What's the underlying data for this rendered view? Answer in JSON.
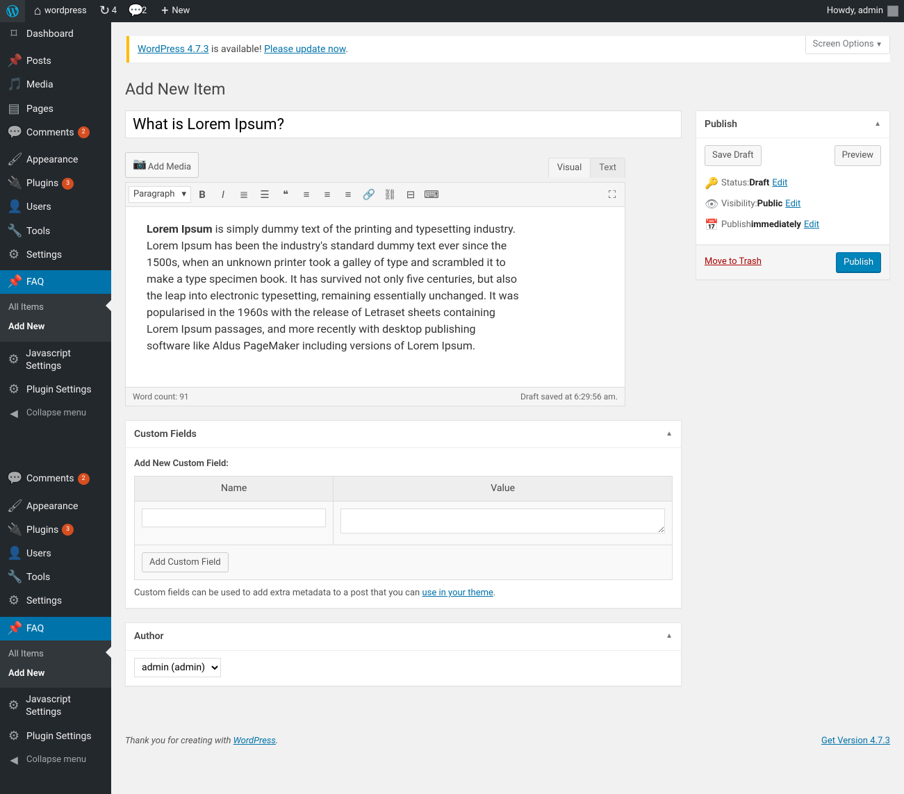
{
  "adminbar": {
    "site_name": "wordpress",
    "updates_count": "4",
    "comments_count": "2",
    "new_label": "New",
    "howdy": "Howdy, admin"
  },
  "screen_options": "Screen Options",
  "update_nag": {
    "link1": "WordPress 4.7.3",
    "mid": " is available! ",
    "link2": "Please update now"
  },
  "page_heading": "Add New Item",
  "title_value": "What is Lorem Ipsum?",
  "media_button": "Add Media",
  "editor_tabs": {
    "visual": "Visual",
    "text": "Text"
  },
  "format_select": "Paragraph",
  "editor_text_bold": "Lorem Ipsum",
  "editor_text_rest": " is simply dummy text of the printing and typesetting industry. Lorem Ipsum has been the industry's standard dummy text ever since the 1500s, when an unknown printer took a galley of type and scrambled it to make a type specimen book. It has survived not only five centuries, but also the leap into electronic typesetting, remaining essentially unchanged. It was popularised in the 1960s with the release of Letraset sheets containing Lorem Ipsum passages, and more recently with desktop publishing software like Aldus PageMaker including versions of Lorem Ipsum.",
  "word_count_label": "Word count: ",
  "word_count": "91",
  "autosave": "Draft saved at 6:29:56 am.",
  "publish_box": {
    "title": "Publish",
    "save_draft": "Save Draft",
    "preview": "Preview",
    "status_label": "Status: ",
    "status_value": "Draft",
    "visibility_label": "Visibility: ",
    "visibility_value": "Public",
    "schedule_label": "Publish ",
    "schedule_value": "immediately",
    "edit": "Edit",
    "trash": "Move to Trash",
    "publish": "Publish"
  },
  "custom_fields": {
    "title": "Custom Fields",
    "heading": "Add New Custom Field:",
    "name_col": "Name",
    "value_col": "Value",
    "add_btn": "Add Custom Field",
    "help_pre": "Custom fields can be used to add extra metadata to a post that you can ",
    "help_link": "use in your theme"
  },
  "author_box": {
    "title": "Author",
    "selected": "admin (admin)"
  },
  "sidebar": {
    "dashboard": "Dashboard",
    "posts": "Posts",
    "media": "Media",
    "pages": "Pages",
    "comments": "Comments",
    "comments_badge": "2",
    "appearance": "Appearance",
    "plugins": "Plugins",
    "plugins_badge": "3",
    "users": "Users",
    "tools": "Tools",
    "settings": "Settings",
    "faq": "FAQ",
    "faq_sub_all": "All Items",
    "faq_sub_add": "Add New",
    "js_settings": "Javascript Settings",
    "plugin_settings": "Plugin Settings",
    "collapse": "Collapse menu"
  },
  "footer": {
    "thanks_pre": "Thank you for creating with ",
    "thanks_link": "WordPress",
    "version": "Get Version 4.7.3"
  }
}
